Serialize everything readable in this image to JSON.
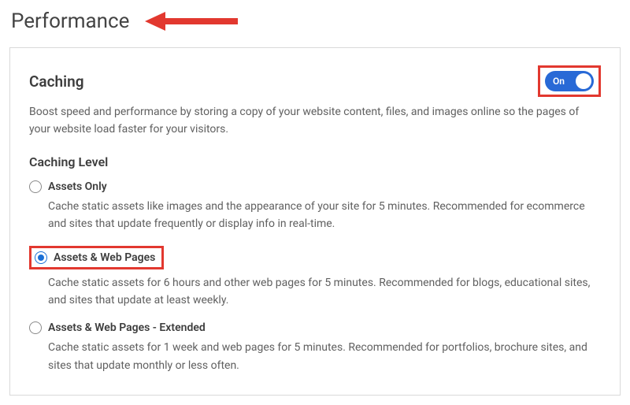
{
  "page": {
    "title": "Performance"
  },
  "caching": {
    "title": "Caching",
    "toggle_label": "On",
    "description": "Boost speed and performance by storing a copy of your website content, files, and images online so the pages of your website load faster for your visitors.",
    "level_title": "Caching Level",
    "options": [
      {
        "label": "Assets Only",
        "desc": "Cache static assets like images and the appearance of your site for 5 minutes. Recommended for ecommerce and sites that update frequently or display info in real-time.",
        "selected": false
      },
      {
        "label": "Assets & Web Pages",
        "desc": "Cache static assets for 6 hours and other web pages for 5 minutes. Recommended for blogs, educational sites, and sites that update at least weekly.",
        "selected": true
      },
      {
        "label": "Assets & Web Pages - Extended",
        "desc": "Cache static assets for 1 week and web pages for 5 minutes. Recommended for portfolios, brochure sites, and sites that update monthly or less often.",
        "selected": false
      }
    ]
  },
  "annotations": {
    "arrow_color": "#e2382f",
    "highlight_color": "#e2382f"
  }
}
